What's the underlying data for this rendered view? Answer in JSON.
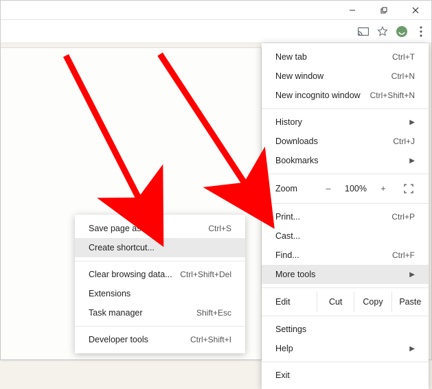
{
  "window_controls": {
    "minimize": "–",
    "maximize": "❐",
    "close": "✕"
  },
  "toolbar_icons": {
    "cast": "cast-icon",
    "star": "star-icon",
    "profile": "profile-icon",
    "menu": "menu-icon"
  },
  "main_menu": {
    "new_tab": {
      "label": "New tab",
      "short": "Ctrl+T"
    },
    "new_window": {
      "label": "New window",
      "short": "Ctrl+N"
    },
    "new_incognito": {
      "label": "New incognito window",
      "short": "Ctrl+Shift+N"
    },
    "history": {
      "label": "History"
    },
    "downloads": {
      "label": "Downloads",
      "short": "Ctrl+J"
    },
    "bookmarks": {
      "label": "Bookmarks"
    },
    "zoom": {
      "label": "Zoom",
      "minus": "–",
      "value": "100%",
      "plus": "+"
    },
    "print": {
      "label": "Print...",
      "short": "Ctrl+P"
    },
    "cast": {
      "label": "Cast..."
    },
    "find": {
      "label": "Find...",
      "short": "Ctrl+F"
    },
    "more_tools": {
      "label": "More tools"
    },
    "edit": {
      "label": "Edit",
      "cut": "Cut",
      "copy": "Copy",
      "paste": "Paste"
    },
    "settings": {
      "label": "Settings"
    },
    "help": {
      "label": "Help"
    },
    "exit": {
      "label": "Exit"
    }
  },
  "sub_menu": {
    "save_page": {
      "label": "Save page as...",
      "short": "Ctrl+S"
    },
    "create_shortcut": {
      "label": "Create shortcut..."
    },
    "clear_browsing": {
      "label": "Clear browsing data...",
      "short": "Ctrl+Shift+Del"
    },
    "extensions": {
      "label": "Extensions"
    },
    "task_manager": {
      "label": "Task manager",
      "short": "Shift+Esc"
    },
    "dev_tools": {
      "label": "Developer tools",
      "short": "Ctrl+Shift+I"
    }
  }
}
